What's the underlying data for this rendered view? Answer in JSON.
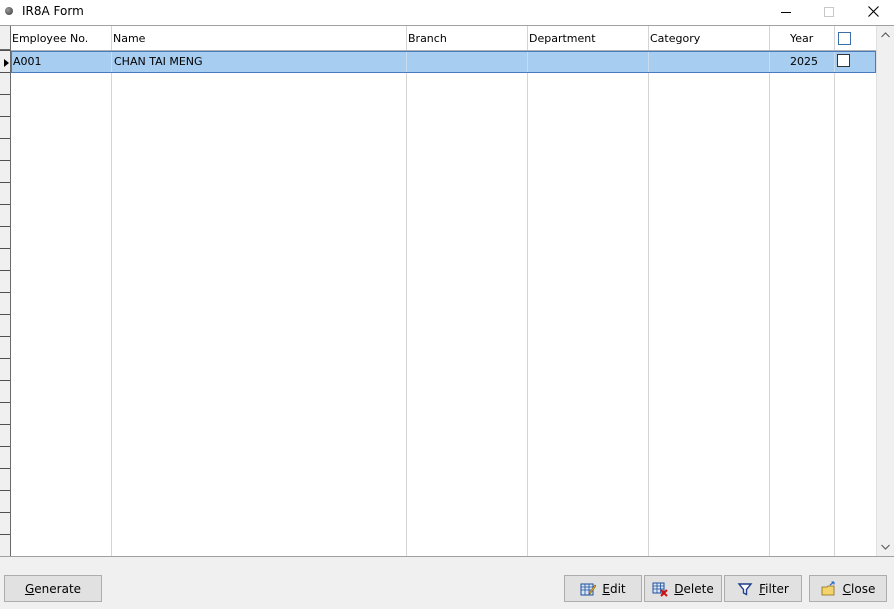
{
  "window": {
    "title": "IR8A Form"
  },
  "grid": {
    "columns": [
      "Employee No.",
      "Name",
      "Branch",
      "Department",
      "Category",
      "Year"
    ],
    "rows": [
      {
        "employee_no": "A001",
        "name": "CHAN TAI MENG",
        "branch": "",
        "department": "",
        "category": "",
        "year": "2025"
      }
    ]
  },
  "buttons": {
    "generate": {
      "accel": "G",
      "rest": "enerate"
    },
    "edit": {
      "accel": "E",
      "rest": "dit"
    },
    "delete": {
      "accel": "D",
      "rest": "elete"
    },
    "filter": {
      "accel": "F",
      "rest": "ilter"
    },
    "close": {
      "accel": "C",
      "rest": "lose"
    }
  },
  "colors": {
    "selection": "#a7cdf0",
    "selection_border": "#4a7bbf",
    "button_bg": "#e1e1e1"
  }
}
